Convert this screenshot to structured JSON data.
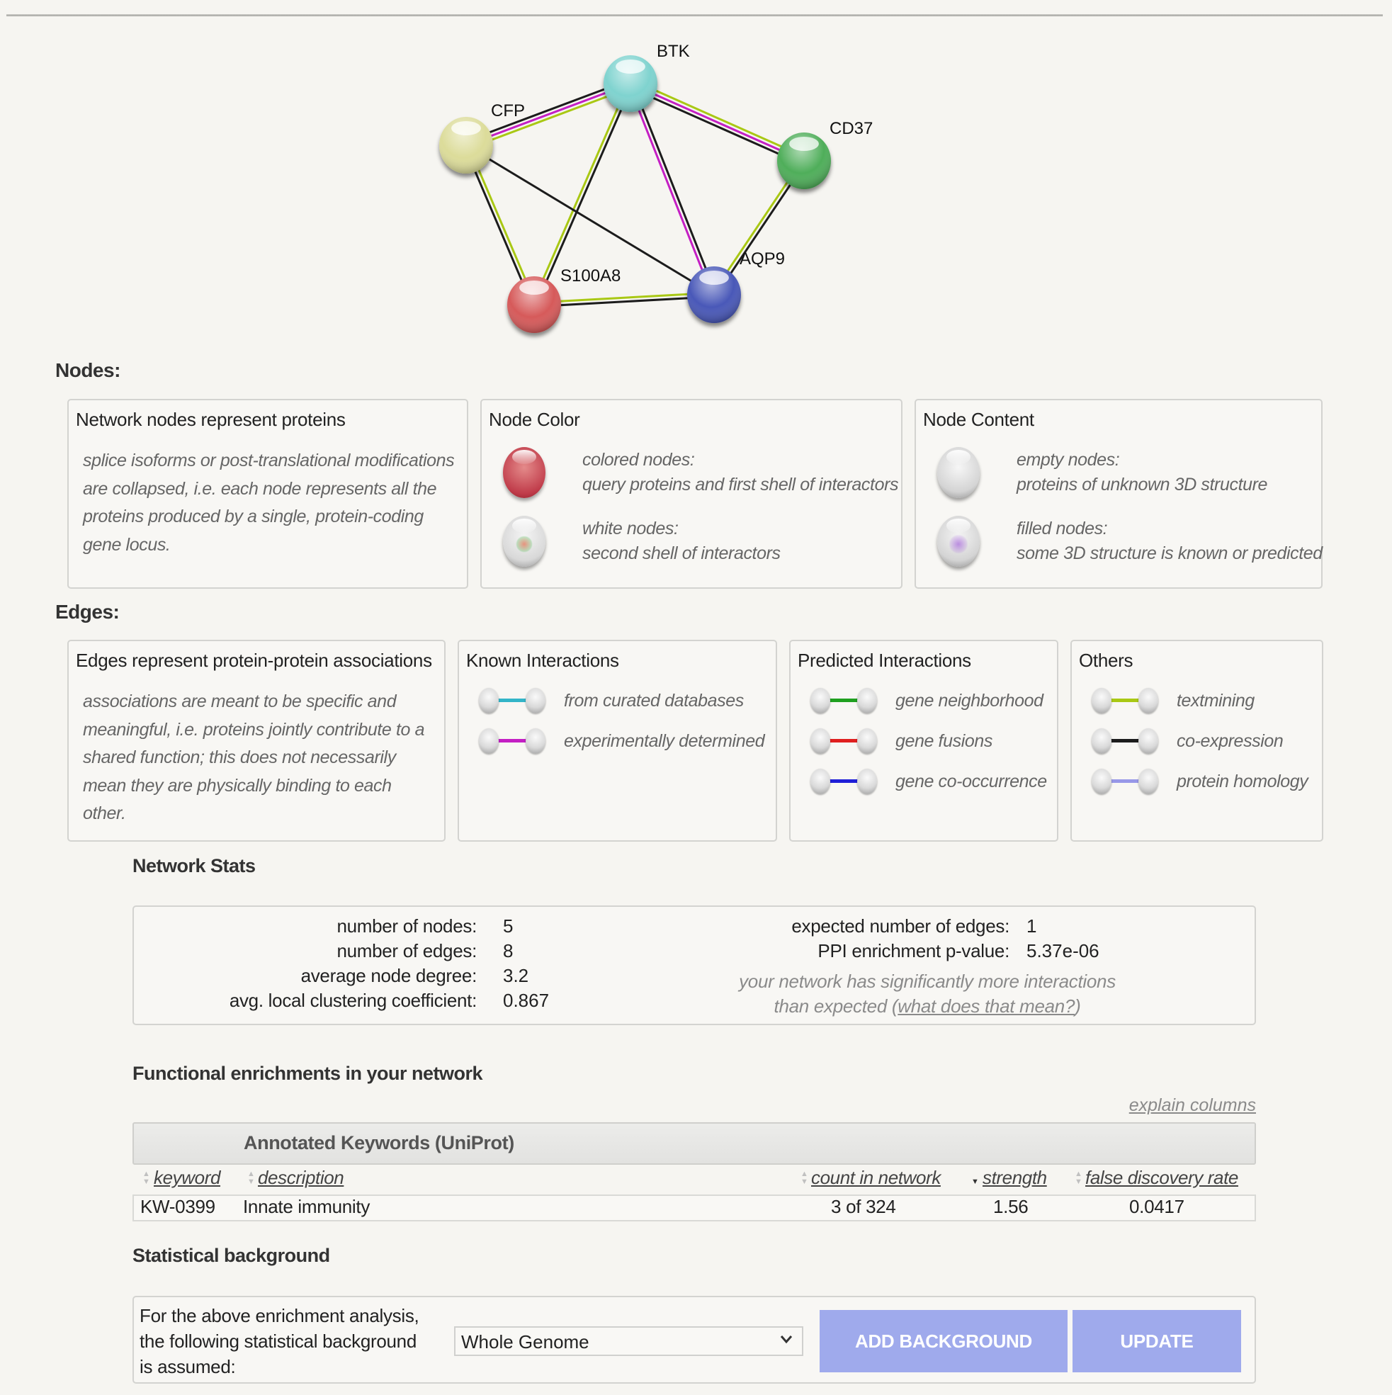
{
  "network": {
    "nodes": [
      {
        "id": "BTK",
        "label": "BTK",
        "color": "#7fd3cf"
      },
      {
        "id": "CFP",
        "label": "CFP",
        "color": "#dcdc9a"
      },
      {
        "id": "CD37",
        "label": "CD37",
        "color": "#4fae5a"
      },
      {
        "id": "S100A8",
        "label": "S100A8",
        "color": "#d65a5a"
      },
      {
        "id": "AQP9",
        "label": "AQP9",
        "color": "#4858b8"
      }
    ],
    "edges": [
      {
        "source": "CFP",
        "target": "BTK",
        "evidence": [
          "co-expression",
          "experimentally determined",
          "textmining"
        ]
      },
      {
        "source": "BTK",
        "target": "CD37",
        "evidence": [
          "textmining",
          "experimentally determined",
          "co-expression"
        ]
      },
      {
        "source": "BTK",
        "target": "S100A8",
        "evidence": [
          "co-expression",
          "textmining"
        ]
      },
      {
        "source": "BTK",
        "target": "AQP9",
        "evidence": [
          "co-expression",
          "experimentally determined"
        ]
      },
      {
        "source": "CFP",
        "target": "S100A8",
        "evidence": [
          "textmining",
          "co-expression"
        ]
      },
      {
        "source": "CFP",
        "target": "AQP9",
        "evidence": [
          "co-expression"
        ]
      },
      {
        "source": "S100A8",
        "target": "AQP9",
        "evidence": [
          "textmining",
          "co-expression"
        ]
      },
      {
        "source": "CD37",
        "target": "AQP9",
        "evidence": [
          "co-expression",
          "textmining"
        ]
      }
    ],
    "evidence_colors": {
      "from curated databases": "#33b5c8",
      "experimentally determined": "#c41fc4",
      "gene neighborhood": "#1fa01f",
      "gene fusions": "#e01f1f",
      "gene co-occurrence": "#1f1fd8",
      "textmining": "#a9c814",
      "co-expression": "#1c1c1c",
      "protein homology": "#9898e8"
    }
  },
  "nodes_section": {
    "heading": "Nodes:",
    "box1": {
      "title": "Network nodes represent proteins",
      "description": "splice isoforms or post-translational modifications are collapsed, i.e. each node represents all the proteins produced by a single, protein-coding gene locus."
    },
    "box2": {
      "title": "Node Color",
      "items": [
        {
          "icon": "colored-node-icon",
          "line1": "colored nodes:",
          "line2": "query proteins and first shell of interactors"
        },
        {
          "icon": "white-node-icon",
          "line1": "white nodes:",
          "line2": "second shell of interactors"
        }
      ]
    },
    "box3": {
      "title": "Node Content",
      "items": [
        {
          "icon": "empty-node-icon",
          "line1": "empty nodes:",
          "line2": "proteins of unknown 3D structure"
        },
        {
          "icon": "filled-node-icon",
          "line1": "filled nodes:",
          "line2": "some 3D structure is known or predicted"
        }
      ]
    }
  },
  "edges_section": {
    "heading": "Edges:",
    "box1": {
      "title": "Edges represent protein-protein associations",
      "description": "associations are meant to be specific and meaningful, i.e. proteins jointly contribute to a shared function; this does not necessarily mean they are physically binding to each other."
    },
    "known": {
      "title": "Known Interactions",
      "items": [
        {
          "label": "from curated databases",
          "color": "#33b5c8"
        },
        {
          "label": "experimentally determined",
          "color": "#c41fc4"
        }
      ]
    },
    "predicted": {
      "title": "Predicted Interactions",
      "items": [
        {
          "label": "gene neighborhood",
          "color": "#1fa01f"
        },
        {
          "label": "gene fusions",
          "color": "#e01f1f"
        },
        {
          "label": "gene co-occurrence",
          "color": "#1f1fd8"
        }
      ]
    },
    "others": {
      "title": "Others",
      "items": [
        {
          "label": "textmining",
          "color": "#a9c814"
        },
        {
          "label": "co-expression",
          "color": "#1c1c1c"
        },
        {
          "label": "protein homology",
          "color": "#9898e8"
        }
      ]
    }
  },
  "stats": {
    "heading": "Network Stats",
    "left": [
      {
        "label": "number of nodes:",
        "value": "5"
      },
      {
        "label": "number of edges:",
        "value": "8"
      },
      {
        "label": "average node degree:",
        "value": "3.2"
      },
      {
        "label": "avg. local clustering coefficient:",
        "value": "0.867"
      }
    ],
    "right": [
      {
        "label": "expected number of edges:",
        "value": "1"
      },
      {
        "label": "PPI enrichment p-value:",
        "value": "5.37e-06"
      }
    ],
    "note_line1": "your network has significantly more interactions",
    "note_line2_prefix": "than expected (",
    "note_link": "what does that mean?",
    "note_line2_suffix": ")"
  },
  "enrichment": {
    "heading": "Functional enrichments in your network",
    "explain_link": "explain columns",
    "category": "Annotated Keywords (UniProt)",
    "columns": [
      "keyword",
      "description",
      "count in network",
      "strength",
      "false discovery rate"
    ],
    "sorted_column": "strength",
    "rows": [
      {
        "keyword": "KW-0399",
        "description": "Innate immunity",
        "count": "3 of 324",
        "strength": "1.56",
        "fdr": "0.0417"
      }
    ]
  },
  "background": {
    "heading": "Statistical background",
    "text_line1": "For the above enrichment analysis,",
    "text_line2": "the following statistical background",
    "text_line3": "is assumed:",
    "select_value": "Whole Genome",
    "add_button": "ADD BACKGROUND",
    "update_button": "UPDATE",
    "button_color": "#9faaec"
  }
}
